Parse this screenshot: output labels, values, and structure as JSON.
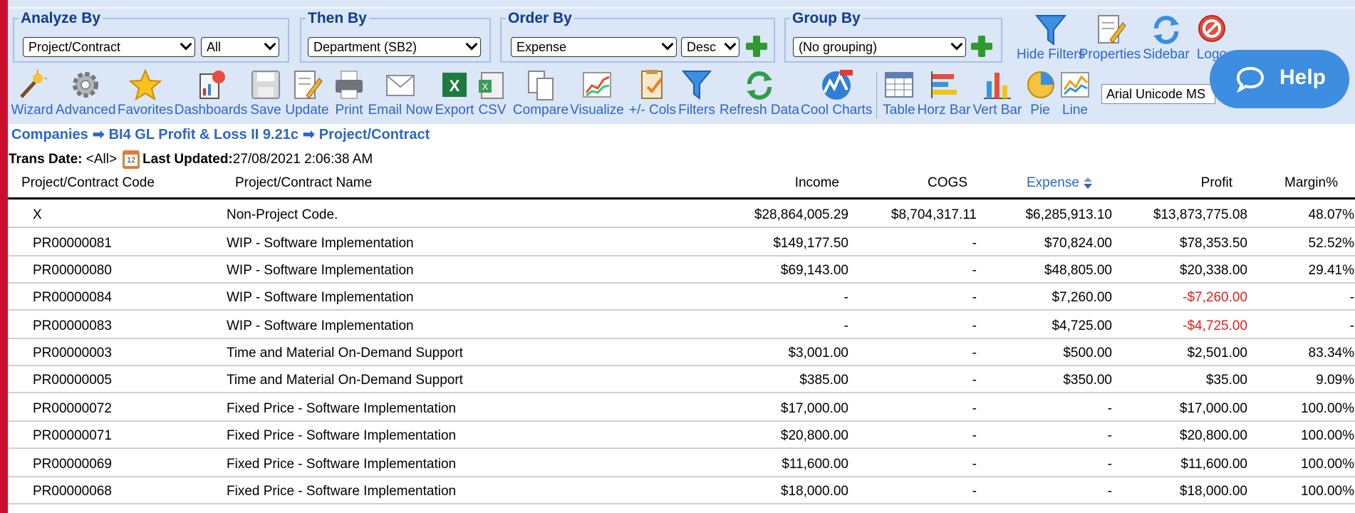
{
  "filters": {
    "analyze_by": {
      "legend": "Analyze By",
      "value": "Project/Contract",
      "value2": "All"
    },
    "then_by": {
      "legend": "Then By",
      "value": "Department (SB2)"
    },
    "order_by": {
      "legend": "Order By",
      "value": "Expense",
      "direction": "Desc"
    },
    "group_by": {
      "legend": "Group By",
      "value": "(No grouping)"
    }
  },
  "top_actions": [
    {
      "label": "Hide Filters",
      "icon": "funnel-icon"
    },
    {
      "label": "Properties",
      "icon": "properties-icon"
    },
    {
      "label": "Sidebar",
      "icon": "sidebar-refresh-icon"
    },
    {
      "label": "Logo",
      "icon": "logout-icon"
    }
  ],
  "toolbar": [
    {
      "label": "Wizard",
      "icon": "wizard-icon"
    },
    {
      "label": "Advanced",
      "icon": "gear-icon"
    },
    {
      "label": "Favorites",
      "icon": "star-icon"
    },
    {
      "label": "Dashboards",
      "icon": "dashboard-icon"
    },
    {
      "label": "Save",
      "icon": "save-icon"
    },
    {
      "label": "Update",
      "icon": "update-icon"
    },
    {
      "label": "Print",
      "icon": "print-icon"
    },
    {
      "label": "Email Now",
      "icon": "email-icon"
    },
    {
      "label": "Export",
      "icon": "excel-icon"
    },
    {
      "label": "CSV",
      "icon": "csv-icon"
    },
    {
      "label": "Compare",
      "icon": "compare-icon"
    },
    {
      "label": "Visualize",
      "icon": "visualize-icon"
    },
    {
      "label": "+/- Cols",
      "icon": "columns-icon"
    },
    {
      "label": "Filters",
      "icon": "funnel-icon"
    },
    {
      "label": "Refresh Data",
      "icon": "refresh-icon"
    },
    {
      "label": "Cool Charts",
      "icon": "cool-charts-icon"
    },
    {
      "label": "Table",
      "icon": "table-icon"
    },
    {
      "label": "Horz Bar",
      "icon": "horizontal-bar-icon"
    },
    {
      "label": "Vert Bar",
      "icon": "vertical-bar-icon"
    },
    {
      "label": "Pie",
      "icon": "pie-icon"
    },
    {
      "label": "Line",
      "icon": "line-chart-icon"
    }
  ],
  "font_select": "Arial Unicode MS",
  "help_label": "Help",
  "breadcrumb": [
    "Companies",
    "BI4 GL Profit & Loss II 9.21c",
    "Project/Contract"
  ],
  "trans_date_label": "Trans Date:",
  "trans_date_value": "<All>",
  "last_updated_label": "Last Updated:",
  "last_updated_value": "27/08/2021 2:06:38 AM",
  "columns": [
    "Project/Contract Code",
    "Project/Contract Name",
    "Income",
    "COGS",
    "Expense",
    "Profit",
    "Margin%"
  ],
  "rows": [
    {
      "code": "X",
      "name": "Non-Project Code.",
      "income": "$28,864,005.29",
      "cogs": "$8,704,317.11",
      "expense": "$6,285,913.10",
      "profit": "$13,873,775.08",
      "margin": "48.07%"
    },
    {
      "code": "PR00000081",
      "name": "WIP - Software Implementation",
      "income": "$149,177.50",
      "cogs": "-",
      "expense": "$70,824.00",
      "profit": "$78,353.50",
      "margin": "52.52%"
    },
    {
      "code": "PR00000080",
      "name": "WIP - Software Implementation",
      "income": "$69,143.00",
      "cogs": "-",
      "expense": "$48,805.00",
      "profit": "$20,338.00",
      "margin": "29.41%"
    },
    {
      "code": "PR00000084",
      "name": "WIP - Software Implementation",
      "income": "-",
      "cogs": "-",
      "expense": "$7,260.00",
      "profit": "-$7,260.00",
      "margin": "-"
    },
    {
      "code": "PR00000083",
      "name": "WIP - Software Implementation",
      "income": "-",
      "cogs": "-",
      "expense": "$4,725.00",
      "profit": "-$4,725.00",
      "margin": "-"
    },
    {
      "code": "PR00000003",
      "name": "Time and Material On-Demand Support",
      "income": "$3,001.00",
      "cogs": "-",
      "expense": "$500.00",
      "profit": "$2,501.00",
      "margin": "83.34%"
    },
    {
      "code": "PR00000005",
      "name": "Time and Material On-Demand Support",
      "income": "$385.00",
      "cogs": "-",
      "expense": "$350.00",
      "profit": "$35.00",
      "margin": "9.09%"
    },
    {
      "code": "PR00000072",
      "name": "Fixed Price - Software Implementation",
      "income": "$17,000.00",
      "cogs": "-",
      "expense": "-",
      "profit": "$17,000.00",
      "margin": "100.00%"
    },
    {
      "code": "PR00000071",
      "name": "Fixed Price - Software Implementation",
      "income": "$20,800.00",
      "cogs": "-",
      "expense": "-",
      "profit": "$20,800.00",
      "margin": "100.00%"
    },
    {
      "code": "PR00000069",
      "name": "Fixed Price - Software Implementation",
      "income": "$11,600.00",
      "cogs": "-",
      "expense": "-",
      "profit": "$11,600.00",
      "margin": "100.00%"
    },
    {
      "code": "PR00000068",
      "name": "Fixed Price - Software Implementation",
      "income": "$18,000.00",
      "cogs": "-",
      "expense": "-",
      "profit": "$18,000.00",
      "margin": "100.00%"
    }
  ],
  "colors": {
    "accent": "#2a67c9",
    "negative": "#e02020",
    "header_bg": "#dbe6f6",
    "left_stripe": "#c8102e",
    "help_bg": "#3d8de0"
  }
}
